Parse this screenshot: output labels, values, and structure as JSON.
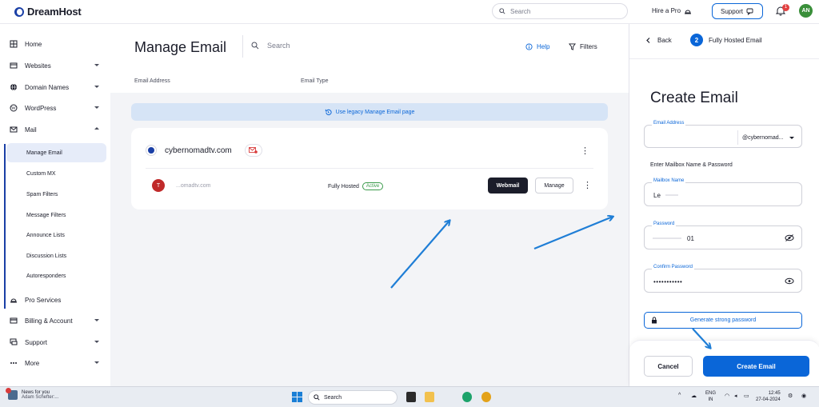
{
  "topbar": {
    "logo_text": "DreamHost",
    "search_placeholder": "Search",
    "hire_pro": "Hire a Pro",
    "support": "Support",
    "notifications_count": "1",
    "avatar_initials": "AN"
  },
  "sidebar": {
    "items": [
      {
        "label": "Home"
      },
      {
        "label": "Websites"
      },
      {
        "label": "Domain Names"
      },
      {
        "label": "WordPress"
      },
      {
        "label": "Mail"
      },
      {
        "label": "Pro Services"
      },
      {
        "label": "Billing & Account"
      },
      {
        "label": "Support"
      },
      {
        "label": "More"
      }
    ],
    "mail_sub": [
      {
        "label": "Manage Email"
      },
      {
        "label": "Custom MX"
      },
      {
        "label": "Spam Filters"
      },
      {
        "label": "Message Filters"
      },
      {
        "label": "Announce Lists"
      },
      {
        "label": "Discussion Lists"
      },
      {
        "label": "Autoresponders"
      }
    ]
  },
  "main": {
    "title": "Manage Email",
    "search_placeholder": "Search",
    "help": "Help",
    "filters": "Filters",
    "columns": [
      "Email Address",
      "Email Type"
    ],
    "legacy_link": "Use legacy Manage Email page",
    "domain": "cybernomadtv.com",
    "mailbox": {
      "avatar": "T",
      "address": "...omadtv.com",
      "type": "Fully Hosted",
      "status": "Active",
      "webmail": "Webmail",
      "manage": "Manage"
    }
  },
  "panel": {
    "back": "Back",
    "step_number": "2",
    "step_label": "Fully Hosted Email",
    "title": "Create Email",
    "email_address_label": "Email Address",
    "domain_select": "@cybernomad...",
    "section_label": "Enter Mailbox Name & Password",
    "mailbox_name_label": "Mailbox Name",
    "mailbox_name_value": "Le",
    "password_label": "Password",
    "password_value": "01",
    "confirm_label": "Confirm Password",
    "confirm_value": "•••••••••••",
    "generate": "Generate strong password",
    "cancel": "Cancel",
    "create": "Create Email"
  },
  "taskbar": {
    "news_title": "News for you",
    "news_sub": "Adam Schefter:...",
    "search_placeholder": "Search",
    "lang_top": "ENG",
    "lang_bottom": "IN",
    "time": "12:45",
    "date": "27-04-2024"
  },
  "colors": {
    "brand_blue": "#0a66d8",
    "dark_button": "#1b1d2a",
    "active_green": "#3a9a4a",
    "annotation_arrow": "#1f7ed6"
  }
}
